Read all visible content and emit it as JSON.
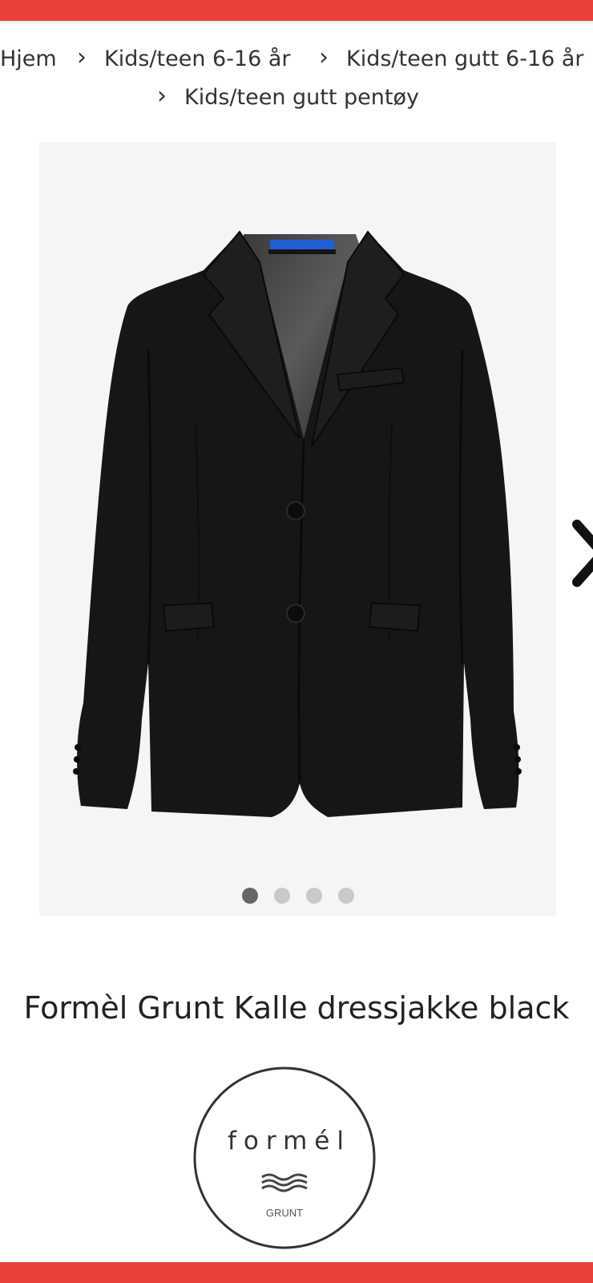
{
  "colors": {
    "accent_bar": "#e8423a",
    "breadcrumb_text": "#333333",
    "gallery_bg": "#f5f5f5",
    "dot_active": "#666666",
    "dot_inactive": "#c9c9c9"
  },
  "breadcrumb": {
    "items": [
      {
        "label": "Hjem"
      },
      {
        "label": "Kids/teen 6-16 år"
      },
      {
        "label": "Kids/teen gutt 6-16 år"
      },
      {
        "label": "Kids/teen gutt pentøy"
      }
    ],
    "separator": "›"
  },
  "gallery": {
    "image_subject": "black suit jacket",
    "slide_count": 4,
    "active_slide": 1,
    "next_icon": "chevron-right-icon"
  },
  "product": {
    "title": "Formèl Grunt Kalle dressjakke black"
  },
  "brand": {
    "logo_text": "formél",
    "logo_subtext": "GRUNT",
    "wave_icon": "waves-icon"
  }
}
